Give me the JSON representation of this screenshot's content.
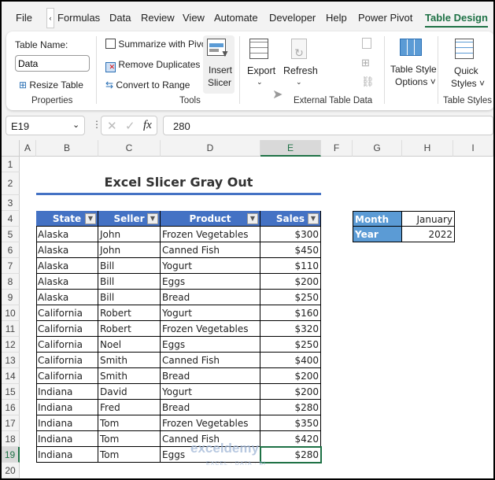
{
  "tabs": [
    "File",
    "Formulas",
    "Data",
    "Review",
    "View",
    "Automate",
    "Developer",
    "Help",
    "Power Pivot",
    "Table Design"
  ],
  "ribbon": {
    "table_name_label": "Table Name:",
    "table_name_value": "Data",
    "resize_table": "Resize Table",
    "properties": "Properties",
    "summarize": "Summarize with PivotTable",
    "remove_duplicates": "Remove Duplicates",
    "convert_range": "Convert to Range",
    "tools": "Tools",
    "insert": "Insert",
    "slicer": "Slicer",
    "export": "Export",
    "refresh": "Refresh",
    "external": "External Table Data",
    "style_options_1": "Table Style",
    "style_options_2": "Options",
    "quick_1": "Quick",
    "quick_2": "Styles",
    "table_styles": "Table Styles"
  },
  "formula_bar": {
    "name_box": "E19",
    "fx": "fx",
    "value": "280"
  },
  "columns": [
    "A",
    "B",
    "C",
    "D",
    "E",
    "F",
    "G",
    "H",
    "I"
  ],
  "rows": [
    "1",
    "2",
    "3",
    "4",
    "5",
    "6",
    "7",
    "8",
    "9",
    "10",
    "11",
    "12",
    "13",
    "14",
    "15",
    "16",
    "17",
    "18",
    "19",
    "20"
  ],
  "title": "Excel Slicer Gray Out",
  "table": {
    "headers": [
      "State",
      "Seller",
      "Product",
      "Sales"
    ],
    "rows": [
      [
        "Alaska",
        "John",
        "Frozen Vegetables",
        "$300"
      ],
      [
        "Alaska",
        "John",
        "Canned Fish",
        "$450"
      ],
      [
        "Alaska",
        "Bill",
        "Yogurt",
        "$110"
      ],
      [
        "Alaska",
        "Bill",
        "Eggs",
        "$200"
      ],
      [
        "Alaska",
        "Bill",
        "Bread",
        "$250"
      ],
      [
        "California",
        "Robert",
        "Yogurt",
        "$160"
      ],
      [
        "California",
        "Robert",
        "Frozen Vegetables",
        "$320"
      ],
      [
        "California",
        "Noel",
        "Eggs",
        "$250"
      ],
      [
        "California",
        "Smith",
        "Canned Fish",
        "$400"
      ],
      [
        "California",
        "Smith",
        "Bread",
        "$200"
      ],
      [
        "Indiana",
        "David",
        "Yogurt",
        "$200"
      ],
      [
        "Indiana",
        "Fred",
        "Bread",
        "$280"
      ],
      [
        "Indiana",
        "Tom",
        "Frozen Vegetables",
        "$350"
      ],
      [
        "Indiana",
        "Tom",
        "Canned Fish",
        "$420"
      ],
      [
        "Indiana",
        "Tom",
        "Eggs",
        "$280"
      ]
    ]
  },
  "criteria": [
    {
      "label": "Month",
      "value": "January"
    },
    {
      "label": "Year",
      "value": "2022"
    }
  ],
  "watermark": "exceldemy",
  "watermark_sub": "EXCEL · DATA · BI"
}
